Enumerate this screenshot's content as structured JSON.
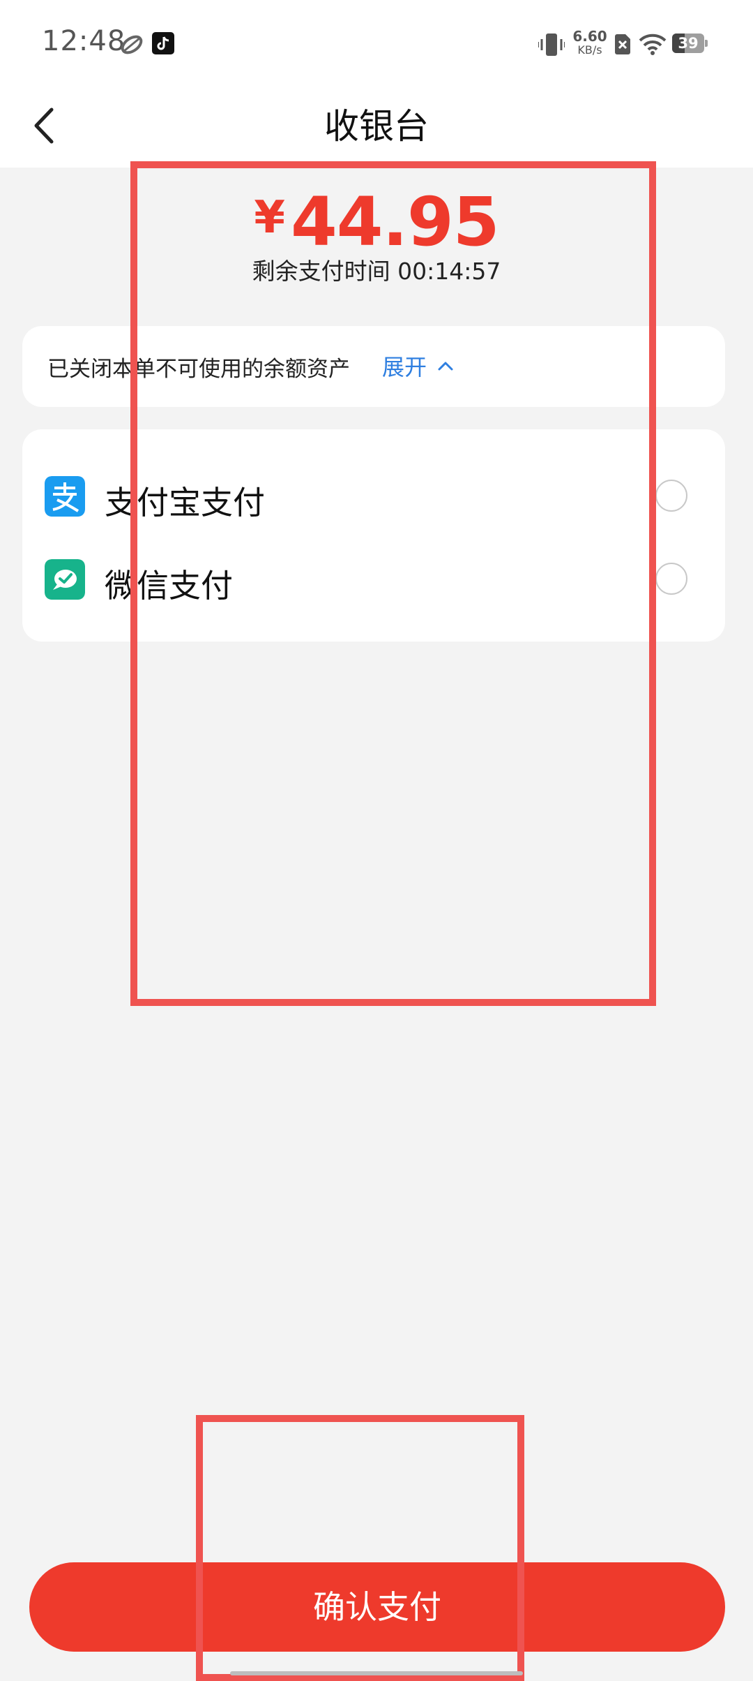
{
  "status_bar": {
    "time": "12:48",
    "network_speed_value": "6.60",
    "network_speed_unit": "KB/s",
    "battery": "39",
    "icons": [
      "sync-icon",
      "tiktok-icon",
      "vibrate-icon",
      "no-sim-icon",
      "wifi-icon",
      "battery-icon"
    ]
  },
  "header": {
    "title": "收银台",
    "back_icon": "chevron-left-icon"
  },
  "payment": {
    "currency_symbol": "¥",
    "amount": "44.95",
    "countdown": "剩余支付时间 00:14:57"
  },
  "notice": {
    "text": "已关闭本单不可使用的余额资产",
    "expand_label": "展开",
    "expand_icon": "chevron-up-icon"
  },
  "methods": [
    {
      "label": "支付宝支付",
      "icon": "alipay-icon",
      "selected": false
    },
    {
      "label": "微信支付",
      "icon": "wechat-pay-icon",
      "selected": false
    }
  ],
  "confirm_button": {
    "label": "确认支付"
  },
  "colors": {
    "accent": "#ee3a2c",
    "link": "#2f7fe0",
    "alipay": "#1a9cf0",
    "wechat": "#17b38b",
    "overlay": "#ef5350",
    "background": "#f3f3f3"
  }
}
